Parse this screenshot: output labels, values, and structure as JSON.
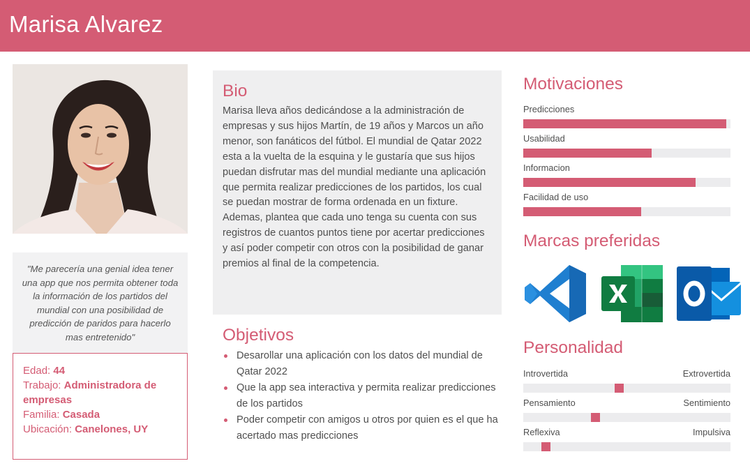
{
  "header": {
    "name": "Marisa Alvarez"
  },
  "colors": {
    "accent": "#d45c74",
    "panel": "#efeff0",
    "track": "#ececee"
  },
  "photo": {
    "alt": "profile-photo"
  },
  "quote": "\"Me parecería una genial idea tener una app que nos permita obtener toda la información de los partidos del mundial con una posibilidad de predicción de paridos para hacerlo mas entretenido\"",
  "info": {
    "age_label": "Edad:",
    "age_value": "44",
    "job_label": "Trabajo:",
    "job_value": "Administradora de empresas",
    "family_label": "Familia:",
    "family_value": "Casada",
    "location_label": "Ubicación:",
    "location_value": "Canelones, UY"
  },
  "bio": {
    "title": "Bio",
    "text": "Marisa lleva años dedicándose a la administración de empresas y sus hijos Martín, de 19 años y Marcos un año menor, son fanáticos del fútbol. El mundial de Qatar 2022 esta a la vuelta de la esquina y le gustaría que sus hijos puedan disfrutar mas del mundial mediante una aplicación que permita realizar predicciones de los partidos, los cual se puedan mostrar de forma ordenada en un fixture. Ademas, plantea que cada uno tenga su cuenta con sus registros de cuantos puntos tiene por acertar predicciones y así poder competir con otros con la posibilidad de ganar premios al final de la competencia."
  },
  "objectives": {
    "title": "Objetivos",
    "items": [
      "Desarollar una aplicación con los datos del mundial de Qatar 2022",
      "Que la app sea interactiva y permita realizar predicciones de los partidos",
      "Poder competir con amigos u otros por quien es el que ha acertado mas predicciones"
    ]
  },
  "motivations": {
    "title": "Motivaciones",
    "items": [
      {
        "label": "Predicciones",
        "level": 0.98
      },
      {
        "label": "Usabilidad",
        "level": 0.62
      },
      {
        "label": "Informacion",
        "level": 0.83
      },
      {
        "label": "Facilidad de uso",
        "level": 0.57
      }
    ]
  },
  "brands": {
    "title": "Marcas preferidas",
    "icons": [
      "vscode-icon",
      "excel-icon",
      "outlook-icon"
    ]
  },
  "personality": {
    "title": "Personalidad",
    "items": [
      {
        "left": "Introvertida",
        "right": "Extrovertida",
        "level": 0.46
      },
      {
        "left": "Pensamiento",
        "right": "Sentimiento",
        "level": 0.34
      },
      {
        "left": "Reflexiva",
        "right": "Impulsiva",
        "level": 0.09
      }
    ]
  }
}
